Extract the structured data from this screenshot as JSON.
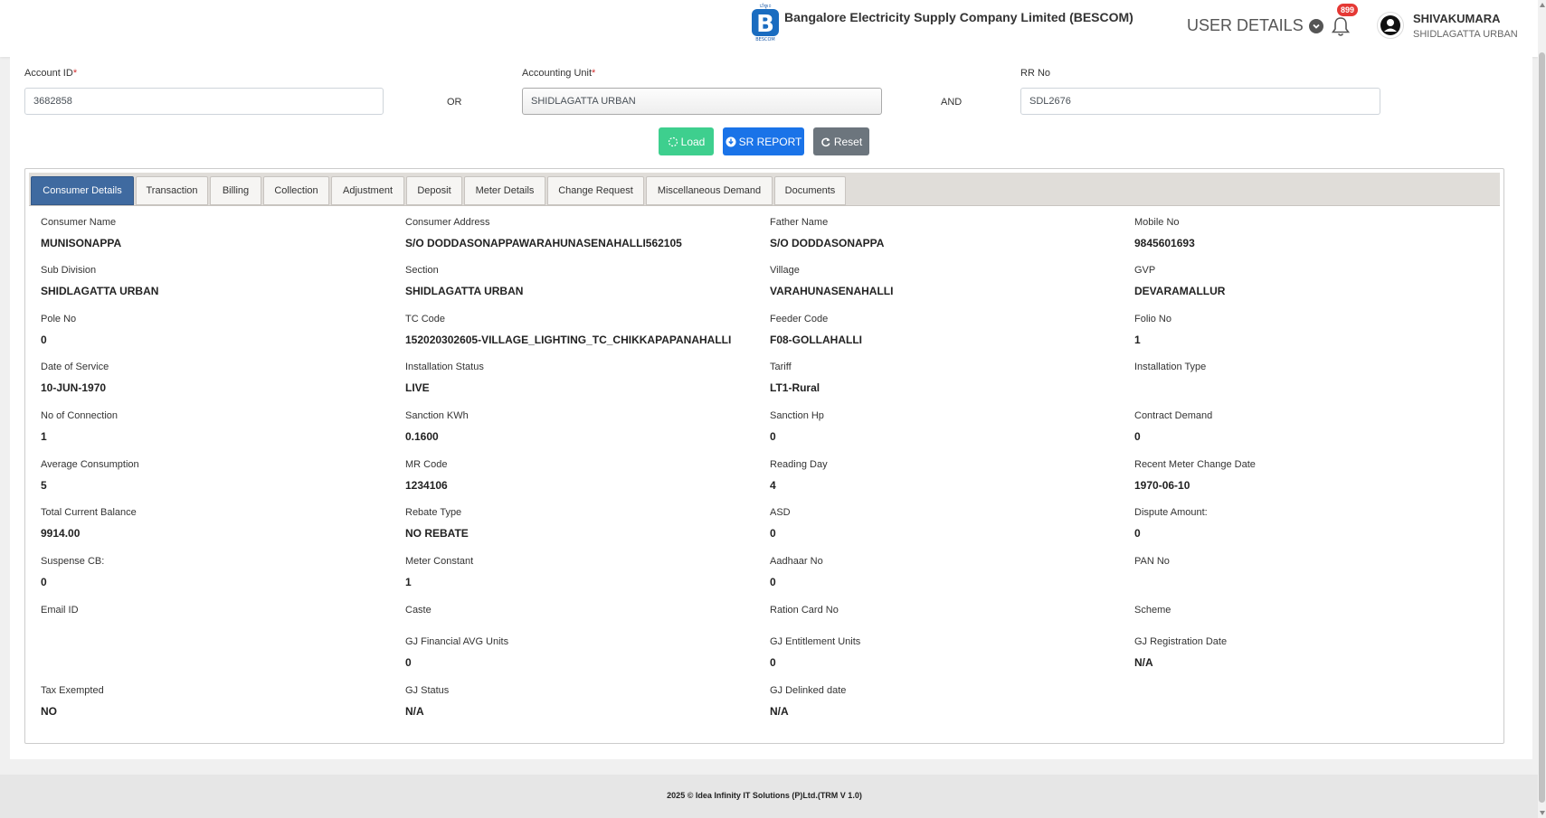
{
  "header": {
    "company_title": "Bangalore Electricity Supply Company Limited (BESCOM)",
    "user_details_label": "USER DETAILS",
    "notification_count": "899",
    "user_name": "SHIVAKUMARA",
    "user_unit": "SHIDLAGATTA URBAN"
  },
  "search": {
    "account_id_label": "Account ID",
    "account_id_value": "3682858",
    "or_text": "OR",
    "accounting_unit_label": "Accounting Unit",
    "accounting_unit_value": "SHIDLAGATTA URBAN",
    "and_text": "AND",
    "rr_no_label": "RR No",
    "rr_no_value": "SDL2676",
    "load_label": "Load",
    "sr_report_label": "SR REPORT",
    "reset_label": "Reset"
  },
  "tabs": [
    {
      "label": "Consumer Details",
      "active": true
    },
    {
      "label": "Transaction"
    },
    {
      "label": "Billing"
    },
    {
      "label": "Collection"
    },
    {
      "label": "Adjustment"
    },
    {
      "label": "Deposit"
    },
    {
      "label": "Meter Details"
    },
    {
      "label": "Change Request"
    },
    {
      "label": "Miscellaneous Demand"
    },
    {
      "label": "Documents"
    }
  ],
  "fields": [
    {
      "label": "Consumer Name",
      "value": "MUNISONAPPA"
    },
    {
      "label": "Consumer Address",
      "value": "S/O DODDASONAPPAWARAHUNASENAHALLI562105"
    },
    {
      "label": "Father Name",
      "value": "S/O DODDASONAPPA"
    },
    {
      "label": "Mobile No",
      "value": "9845601693"
    },
    {
      "label": "Sub Division",
      "value": "SHIDLAGATTA URBAN"
    },
    {
      "label": "Section",
      "value": "SHIDLAGATTA URBAN"
    },
    {
      "label": "Village",
      "value": "VARAHUNASENAHALLI"
    },
    {
      "label": "GVP",
      "value": "DEVARAMALLUR"
    },
    {
      "label": "Pole No",
      "value": "0"
    },
    {
      "label": "TC Code",
      "value": "152020302605-VILLAGE_LIGHTING_TC_CHIKKAPAPANAHALLI"
    },
    {
      "label": "Feeder Code",
      "value": "F08-GOLLAHALLI"
    },
    {
      "label": "Folio No",
      "value": "1"
    },
    {
      "label": "Date of Service",
      "value": "10-JUN-1970"
    },
    {
      "label": "Installation Status",
      "value": "LIVE"
    },
    {
      "label": "Tariff",
      "value": "LT1-Rural"
    },
    {
      "label": "Installation Type",
      "value": ""
    },
    {
      "label": "No of Connection",
      "value": "1"
    },
    {
      "label": "Sanction KWh",
      "value": "0.1600"
    },
    {
      "label": "Sanction Hp",
      "value": "0"
    },
    {
      "label": "Contract Demand",
      "value": "0"
    },
    {
      "label": "Average Consumption",
      "value": "5"
    },
    {
      "label": "MR Code",
      "value": "1234106"
    },
    {
      "label": "Reading Day",
      "value": "4"
    },
    {
      "label": "Recent Meter Change Date",
      "value": "1970-06-10"
    },
    {
      "label": "Total Current Balance",
      "value": "9914.00"
    },
    {
      "label": "Rebate Type",
      "value": "NO REBATE"
    },
    {
      "label": "ASD",
      "value": "0"
    },
    {
      "label": "Dispute Amount:",
      "value": "0"
    },
    {
      "label": "Suspense CB:",
      "value": "0"
    },
    {
      "label": "Meter Constant",
      "value": "1"
    },
    {
      "label": "Aadhaar No",
      "value": "0"
    },
    {
      "label": "PAN No",
      "value": ""
    },
    {
      "label": "Email ID",
      "value": ""
    },
    {
      "label": "Caste",
      "value": ""
    },
    {
      "label": "Ration Card No",
      "value": ""
    },
    {
      "label": "Scheme",
      "value": ""
    },
    {
      "label": "GJ Financial AVG Units",
      "value": "0"
    },
    {
      "label": "GJ Entitlement Units",
      "value": "0"
    },
    {
      "label": "GJ Registration Date",
      "value": "N/A"
    },
    {
      "label": "Tax Exempted",
      "value": "NO"
    },
    {
      "label": "GJ Status",
      "value": "N/A"
    },
    {
      "label": "GJ Delinked date",
      "value": "N/A"
    }
  ],
  "footer": {
    "text": "2025 © Idea Infinity IT Solutions (P)Ltd.(TRM V 1.0)"
  },
  "colors": {
    "active_tab": "#3f6aa0",
    "load_button": "#3ecf8e",
    "sr_report_button": "#1a73e8",
    "reset_button": "#6c757d",
    "badge": "#e53935"
  }
}
